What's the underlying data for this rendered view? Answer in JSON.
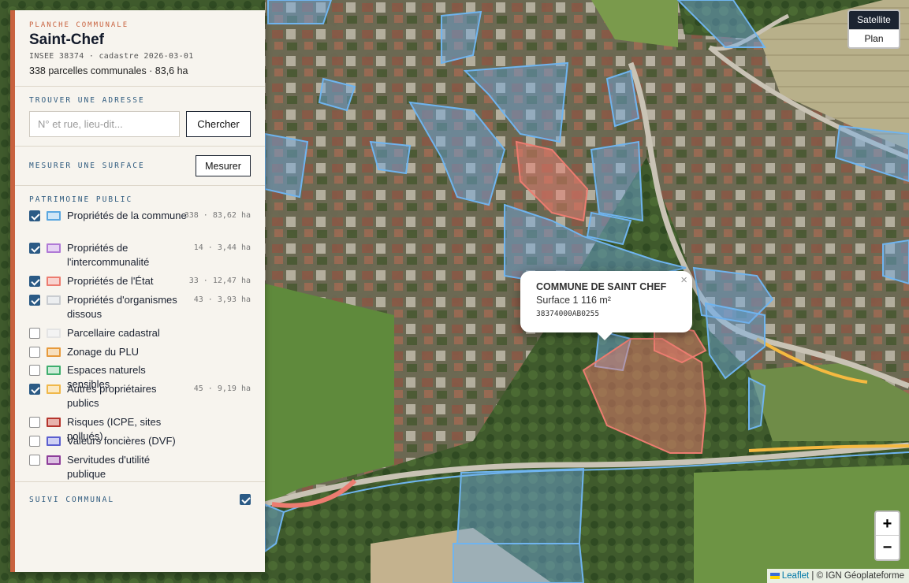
{
  "header": {
    "kicker": "PLANCHE COMMUNALE",
    "title": "Saint-Chef",
    "meta": "INSEE 38374 · cadastre 2026-03-01",
    "summary": "338 parcelles communales · 83,6 ha"
  },
  "search": {
    "title": "TROUVER UNE ADRESSE",
    "placeholder": "N° et rue, lieu-dit...",
    "button": "Chercher"
  },
  "measure": {
    "title": "MESURER UNE SURFACE",
    "button": "Mesurer"
  },
  "layers_title": "PATRIMOINE PUBLIC",
  "layers": [
    {
      "label": "Propriétés de la commune",
      "stat": "338 · 83,62 ha",
      "checked": true,
      "color": "#5aa7e0",
      "fill": "#cfe6f7"
    },
    {
      "label": "Propriétés de l'intercommunalité",
      "stat": "14 · 3,44 ha",
      "checked": true,
      "color": "#b07ad6",
      "fill": "#e6d3f3"
    },
    {
      "label": "Propriétés de l'État",
      "stat": "33 · 12,47 ha",
      "checked": true,
      "color": "#ec7c70",
      "fill": "#f8d3cf"
    },
    {
      "label": "Propriétés d'organismes dissous",
      "stat": "43 · 3,93 ha",
      "checked": true,
      "color": "#c9ccd0",
      "fill": "#eceef0"
    },
    {
      "label": "Parcellaire cadastral",
      "stat": "",
      "checked": false,
      "color": "#e4e4e4",
      "fill": "#f3f3f3"
    },
    {
      "label": "Zonage du PLU",
      "stat": "",
      "checked": false,
      "color": "#e79a3c",
      "fill": "#f7dfbd"
    },
    {
      "label": "Espaces naturels sensibles",
      "stat": "",
      "checked": false,
      "color": "#3fae6e",
      "fill": "#cdebd8"
    },
    {
      "label": "Autres propriétaires publics",
      "stat": "45 · 9,19 ha",
      "checked": true,
      "color": "#f0b84a",
      "fill": "#fbe8c2"
    },
    {
      "label": "Risques (ICPE, sites pollués)",
      "stat": "",
      "checked": false,
      "color": "#b5352d",
      "fill": "#e8b2ac"
    },
    {
      "label": "Valeurs foncières (DVF)",
      "stat": "",
      "checked": false,
      "color": "#5b5fcf",
      "fill": "#cfd0f4"
    },
    {
      "label": "Servitudes d'utilité publique",
      "stat": "",
      "checked": false,
      "color": "#8e3e9a",
      "fill": "#dcc0e2"
    }
  ],
  "monitoring": {
    "label": "SUIVI COMMUNAL",
    "checked": true
  },
  "popup": {
    "title": "COMMUNE DE SAINT CHEF",
    "surface": "Surface 1 116 m²",
    "parcel_id": "38374000AB0255",
    "close": "×"
  },
  "basemap": {
    "active": "Satellite",
    "other": "Plan"
  },
  "zoom": {
    "in": "+",
    "out": "−"
  },
  "attribution": {
    "leaflet": "Leaflet",
    "separator": " | ",
    "source": "© IGN Géoplateforme"
  }
}
